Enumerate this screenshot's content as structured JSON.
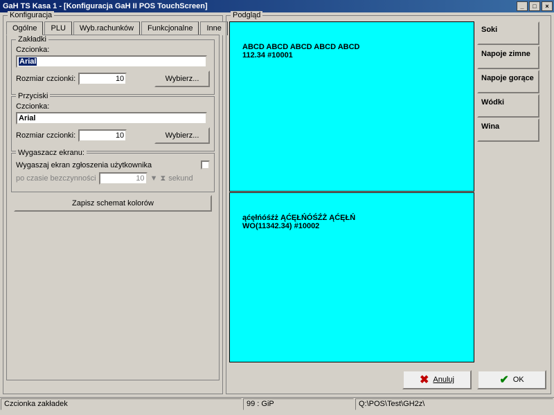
{
  "window": {
    "title": "GaH TS  Kasa 1 - [Konfiguracja GaH II POS TouchScreen]"
  },
  "left_legend": "Konfiguracja",
  "tabs": {
    "t0": "Ogólne",
    "t1": "PLU",
    "t2": "Wyb.rachunków",
    "t3": "Funkcjonalne",
    "t4": "Inne"
  },
  "zakladki": {
    "legend": "Zakładki",
    "font_label": "Czcionka:",
    "font_value": "Arial",
    "size_label": "Rozmiar czcionki:",
    "size_value": "10",
    "choose": "Wybierz..."
  },
  "przyciski": {
    "legend": "Przyciski",
    "font_label": "Czcionka:",
    "font_value": "Arial",
    "size_label": "Rozmiar czcionki:",
    "size_value": "10",
    "choose": "Wybierz..."
  },
  "screensaver": {
    "legend": "Wygaszacz ekranu:",
    "checkbox_label": "Wygaszaj ekran zgłoszenia użytkownika",
    "idle_label": "po czasie bezczynności",
    "idle_value": "10",
    "seconds": "sekund"
  },
  "save_btn": "Zapisz schemat kolorów",
  "right_legend": "Podgląd",
  "tile1": {
    "line1": "ABCD ABCD ABCD ABCD ABCD",
    "line2": "112.34 #10001"
  },
  "tile2": {
    "line1": "ąćęłńóśźż ĄĆĘŁŃÓŚŹŻ ĄĆĘŁŃ",
    "line2": "WO(11342.34) #10002"
  },
  "side": {
    "b0": "Soki",
    "b1": "Napoje zimne",
    "b2": "Napoje gorące",
    "b3": "Wódki",
    "b4": "Wina"
  },
  "actions": {
    "cancel": "Anuluj",
    "ok": "OK"
  },
  "status": {
    "s0": "Czcionka zakładek",
    "s1": "99 : GiP",
    "s2": "Q:\\POS\\Test\\GH2z\\"
  }
}
